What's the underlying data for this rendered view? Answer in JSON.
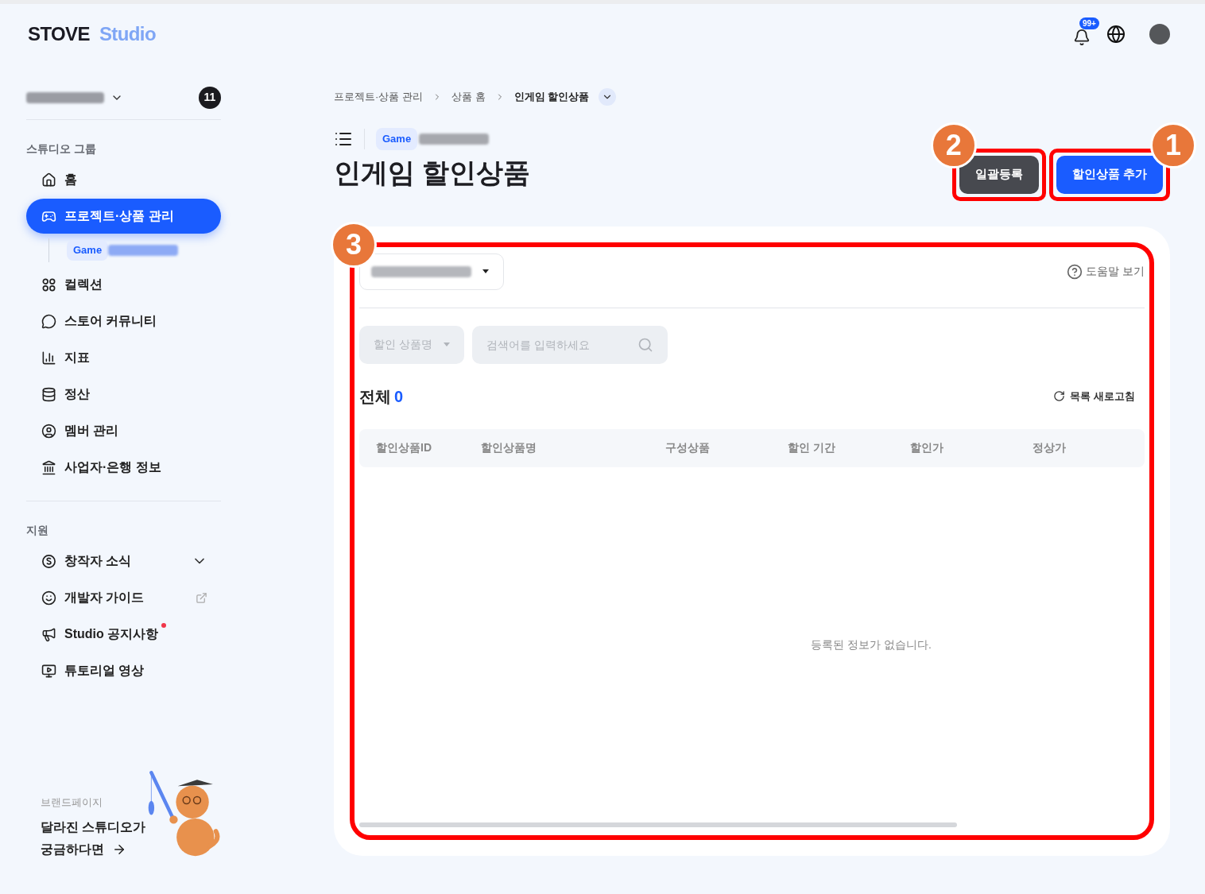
{
  "header": {
    "logo": {
      "brand": "STOVE",
      "product": "Studio"
    },
    "notification_badge": "99+"
  },
  "sidebar": {
    "studio_badge": "11",
    "groups": [
      {
        "title": "스튜디오 그룹",
        "items": [
          {
            "label": "홈",
            "kind": "plain",
            "selected": false
          },
          {
            "label": "프로젝트·상품 관리",
            "kind": "plain",
            "selected": true,
            "children": [
              {
                "tag": "Game"
              }
            ]
          },
          {
            "label": "컬렉션",
            "kind": "plain",
            "selected": false
          },
          {
            "label": "스토어 커뮤니티",
            "kind": "plain",
            "selected": false
          },
          {
            "label": "지표",
            "kind": "plain",
            "selected": false
          },
          {
            "label": "정산",
            "kind": "plain",
            "selected": false
          },
          {
            "label": "멤버 관리",
            "kind": "plain",
            "selected": false
          },
          {
            "label": "사업자·은행 정보",
            "kind": "plain",
            "selected": false
          }
        ]
      },
      {
        "title": "지원",
        "items": [
          {
            "label": "창작자 소식",
            "kind": "expandable",
            "selected": false
          },
          {
            "label": "개발자 가이드",
            "kind": "external",
            "selected": false
          },
          {
            "label": "Studio 공지사항",
            "kind": "new",
            "selected": false
          },
          {
            "label": "튜토리얼 영상",
            "kind": "plain",
            "selected": false
          }
        ]
      }
    ],
    "promo": {
      "eyebrow": "브랜드페이지",
      "lines": [
        "달라진 스튜디오가",
        "궁금하다면"
      ]
    }
  },
  "main": {
    "breadcrumb": [
      "프로젝트·상품 관리",
      "상품 홈",
      "인게임 할인상품"
    ],
    "project_tag": "Game",
    "title": "인게임 할인상품",
    "buttons": [
      {
        "label": "일괄등록",
        "kind": "secondary",
        "callout": "2"
      },
      {
        "label": "할인상품 추가",
        "kind": "primary",
        "callout": "1"
      }
    ],
    "panel": {
      "callout": "3",
      "help": "도움말 보기",
      "filter": "할인 상품명",
      "search": {
        "placeholder": "검색어를 입력하세요"
      },
      "total_label": "전체",
      "total_count": "0",
      "refresh": "목록 새로고침",
      "table": {
        "columns": [
          "할인상품ID",
          "할인상품명",
          "구성상품",
          "할인 기간",
          "할인가",
          "정상가"
        ],
        "empty_message": "등록된 정보가 없습니다."
      }
    }
  }
}
